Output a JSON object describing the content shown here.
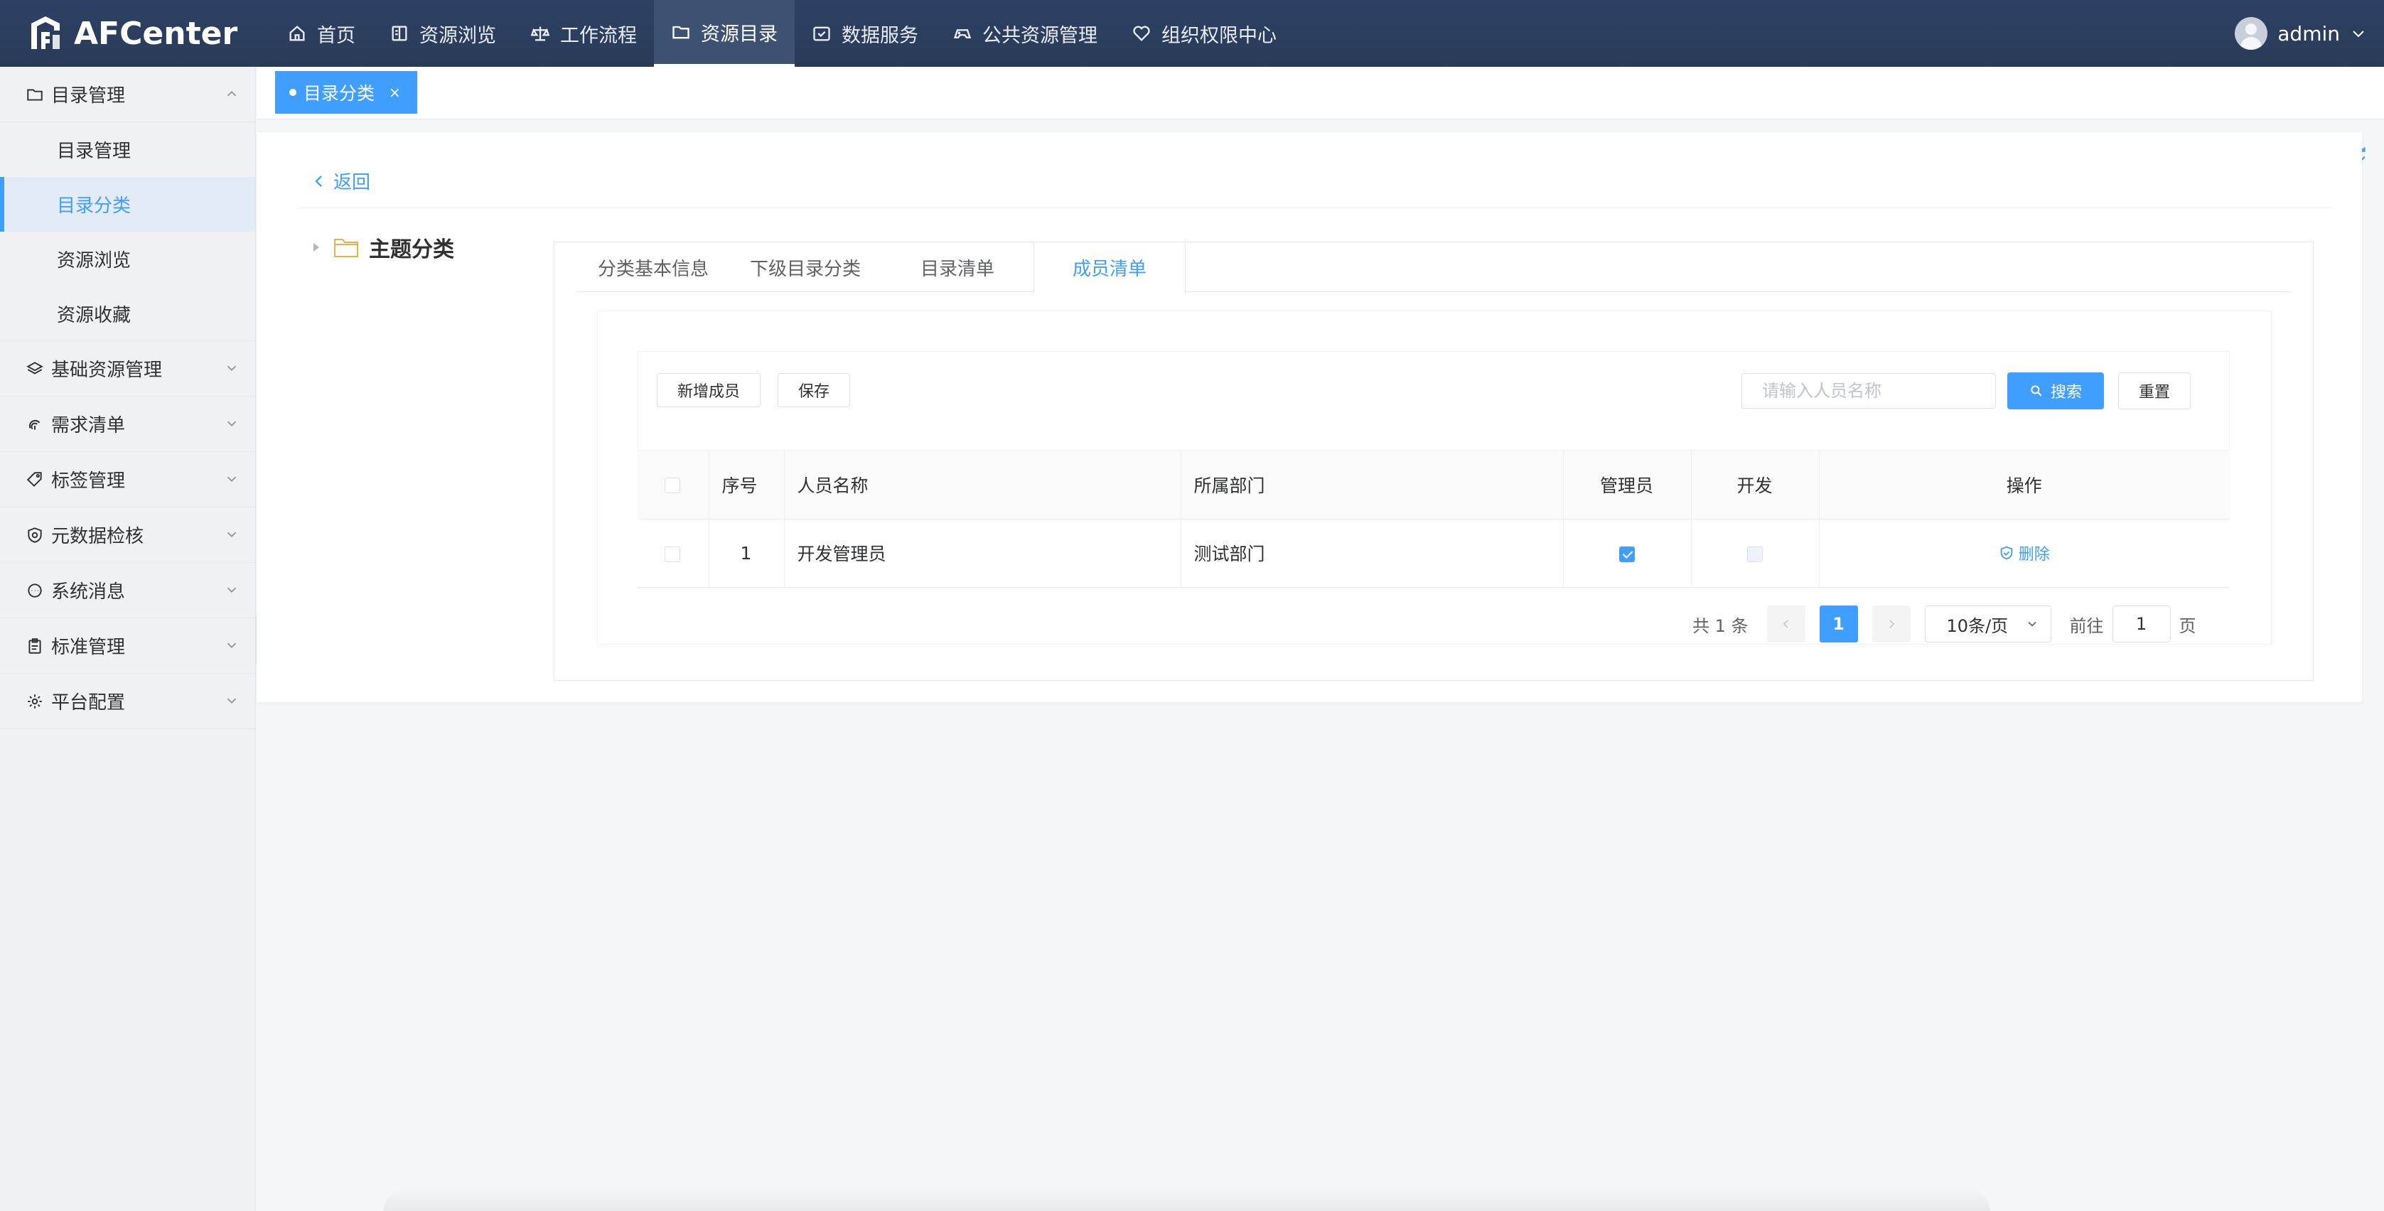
{
  "app": {
    "brand": "AFCenter",
    "user": "admin"
  },
  "nav": [
    {
      "label": "首页",
      "icon": "home-icon"
    },
    {
      "label": "资源浏览",
      "icon": "book-icon"
    },
    {
      "label": "工作流程",
      "icon": "scale-icon"
    },
    {
      "label": "资源目录",
      "icon": "folder-icon",
      "active": true
    },
    {
      "label": "数据服务",
      "icon": "calendar-check-icon"
    },
    {
      "label": "公共资源管理",
      "icon": "gamepad-icon"
    },
    {
      "label": "组织权限中心",
      "icon": "heart-icon"
    }
  ],
  "sidebar": {
    "groups": [
      {
        "label": "目录管理",
        "icon": "folder-icon",
        "expanded": true,
        "items": [
          {
            "label": "目录管理"
          },
          {
            "label": "目录分类",
            "active": true
          },
          {
            "label": "资源浏览"
          },
          {
            "label": "资源收藏"
          }
        ]
      },
      {
        "label": "基础资源管理",
        "icon": "layers-icon"
      },
      {
        "label": "需求清单",
        "icon": "fingerprint-icon"
      },
      {
        "label": "标签管理",
        "icon": "tag-icon"
      },
      {
        "label": "元数据检核",
        "icon": "shield-icon"
      },
      {
        "label": "系统消息",
        "icon": "chat-icon"
      },
      {
        "label": "标准管理",
        "icon": "clipboard-icon"
      },
      {
        "label": "平台配置",
        "icon": "gear-icon"
      }
    ]
  },
  "tagbar": {
    "active_tag": "目录分类",
    "close": "×"
  },
  "page": {
    "back_label": "返回",
    "tree_root": "主题分类",
    "tabs": [
      "分类基本信息",
      "下级目录分类",
      "目录清单",
      "成员清单"
    ],
    "active_tab": "成员清单"
  },
  "toolbar": {
    "add_label": "新增成员",
    "save_label": "保存",
    "search_placeholder": "请输入人员名称",
    "search_label": "搜索",
    "reset_label": "重置"
  },
  "table": {
    "headers": {
      "index": "序号",
      "name": "人员名称",
      "dept": "所属部门",
      "admin": "管理员",
      "dev": "开发",
      "ops": "操作"
    },
    "rows": [
      {
        "index": "1",
        "name": "开发管理员",
        "dept": "测试部门",
        "admin": true,
        "dev": false,
        "op": "删除"
      }
    ]
  },
  "pager": {
    "total": "共 1 条",
    "current": "1",
    "page_size": "10条/页",
    "goto_prefix": "前往",
    "goto_value": "1",
    "goto_suffix": "页"
  },
  "colors": {
    "topbar": "#2c3e5c",
    "accent": "#409eff"
  }
}
